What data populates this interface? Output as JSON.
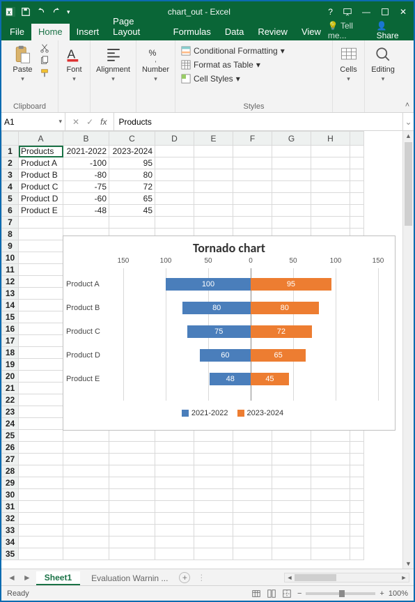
{
  "window": {
    "title": "chart_out - Excel",
    "qa_save": "Save",
    "qa_undo": "Undo",
    "qa_redo": "Redo"
  },
  "tabs": {
    "file": "File",
    "home": "Home",
    "insert": "Insert",
    "page_layout": "Page Layout",
    "formulas": "Formulas",
    "data": "Data",
    "review": "Review",
    "view": "View",
    "tell_me": "Tell me...",
    "share": "Share"
  },
  "ribbon": {
    "clipboard": {
      "paste": "Paste",
      "label": "Clipboard"
    },
    "font": {
      "btn": "Font",
      "label": ""
    },
    "alignment": {
      "btn": "Alignment",
      "label": ""
    },
    "number": {
      "btn": "Number",
      "label": ""
    },
    "styles": {
      "cond": "Conditional Formatting",
      "table": "Format as Table",
      "cell": "Cell Styles",
      "label": "Styles"
    },
    "cells": {
      "btn": "Cells"
    },
    "editing": {
      "btn": "Editing"
    }
  },
  "namebox": {
    "ref": "A1"
  },
  "formula_bar": {
    "fx": "fx",
    "value": "Products"
  },
  "columns": [
    "A",
    "B",
    "C",
    "D",
    "E",
    "F",
    "G",
    "H"
  ],
  "sheet_cells": {
    "headers": [
      "Products",
      "2021-2022",
      "2023-2024"
    ],
    "rows": [
      {
        "a": "Product A",
        "b": "-100",
        "c": "95"
      },
      {
        "a": "Product B",
        "b": "-80",
        "c": "80"
      },
      {
        "a": "Product C",
        "b": "-75",
        "c": "72"
      },
      {
        "a": "Product D",
        "b": "-60",
        "c": "65"
      },
      {
        "a": "Product E",
        "b": "-48",
        "c": "45"
      }
    ]
  },
  "chart_data": {
    "type": "bar",
    "title": "Tornado chart",
    "categories": [
      "Product A",
      "Product B",
      "Product C",
      "Product D",
      "Product E"
    ],
    "series": [
      {
        "name": "2021-2022",
        "values": [
          -100,
          -80,
          -75,
          -60,
          -48
        ],
        "display": [
          100,
          80,
          75,
          60,
          48
        ],
        "color": "#4a7ebb"
      },
      {
        "name": "2023-2024",
        "values": [
          95,
          80,
          72,
          65,
          45
        ],
        "display": [
          95,
          80,
          72,
          65,
          45
        ],
        "color": "#ed7d31"
      }
    ],
    "x_ticks": [
      150,
      100,
      50,
      0,
      50,
      100,
      150
    ],
    "xlim": [
      -150,
      150
    ]
  },
  "sheet_tabs": {
    "active": "Sheet1",
    "other": "Evaluation Warnin  ...",
    "new": "+"
  },
  "status": {
    "ready": "Ready",
    "zoom": "100%"
  }
}
